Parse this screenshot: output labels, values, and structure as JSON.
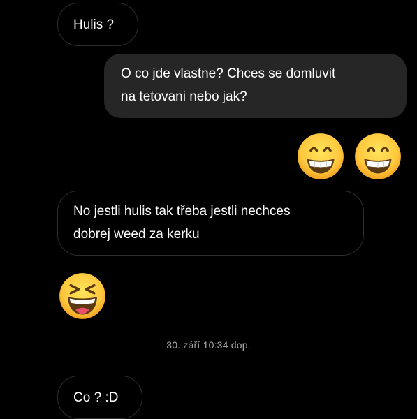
{
  "conversation": {
    "messages": [
      {
        "direction": "incoming",
        "lines": [
          "Hulis ?"
        ]
      },
      {
        "direction": "outgoing",
        "lines": [
          "O co jde vlastne? Chces se domluvit",
          "na tetovani nebo jak?"
        ]
      },
      {
        "direction": "incoming",
        "lines": [
          "No jestli hulis tak třeba jestli nechces",
          "dobrej weed za kerku"
        ]
      },
      {
        "direction": "incoming",
        "lines": [
          "Co ? :D"
        ]
      }
    ],
    "emojis": [
      {
        "icon": "grinning-face-icon",
        "direction": "outgoing"
      },
      {
        "icon": "grinning-face-icon",
        "direction": "outgoing"
      },
      {
        "icon": "laughing-squinting-face-icon",
        "direction": "incoming"
      }
    ],
    "timestamp": "30. září 10:34 dop."
  },
  "theme": {
    "background": "#000000",
    "incoming_border": "#2e2e2e",
    "outgoing_bubble": "#262626",
    "text": "#ffffff",
    "timestamp_text": "#a8a8a8"
  }
}
